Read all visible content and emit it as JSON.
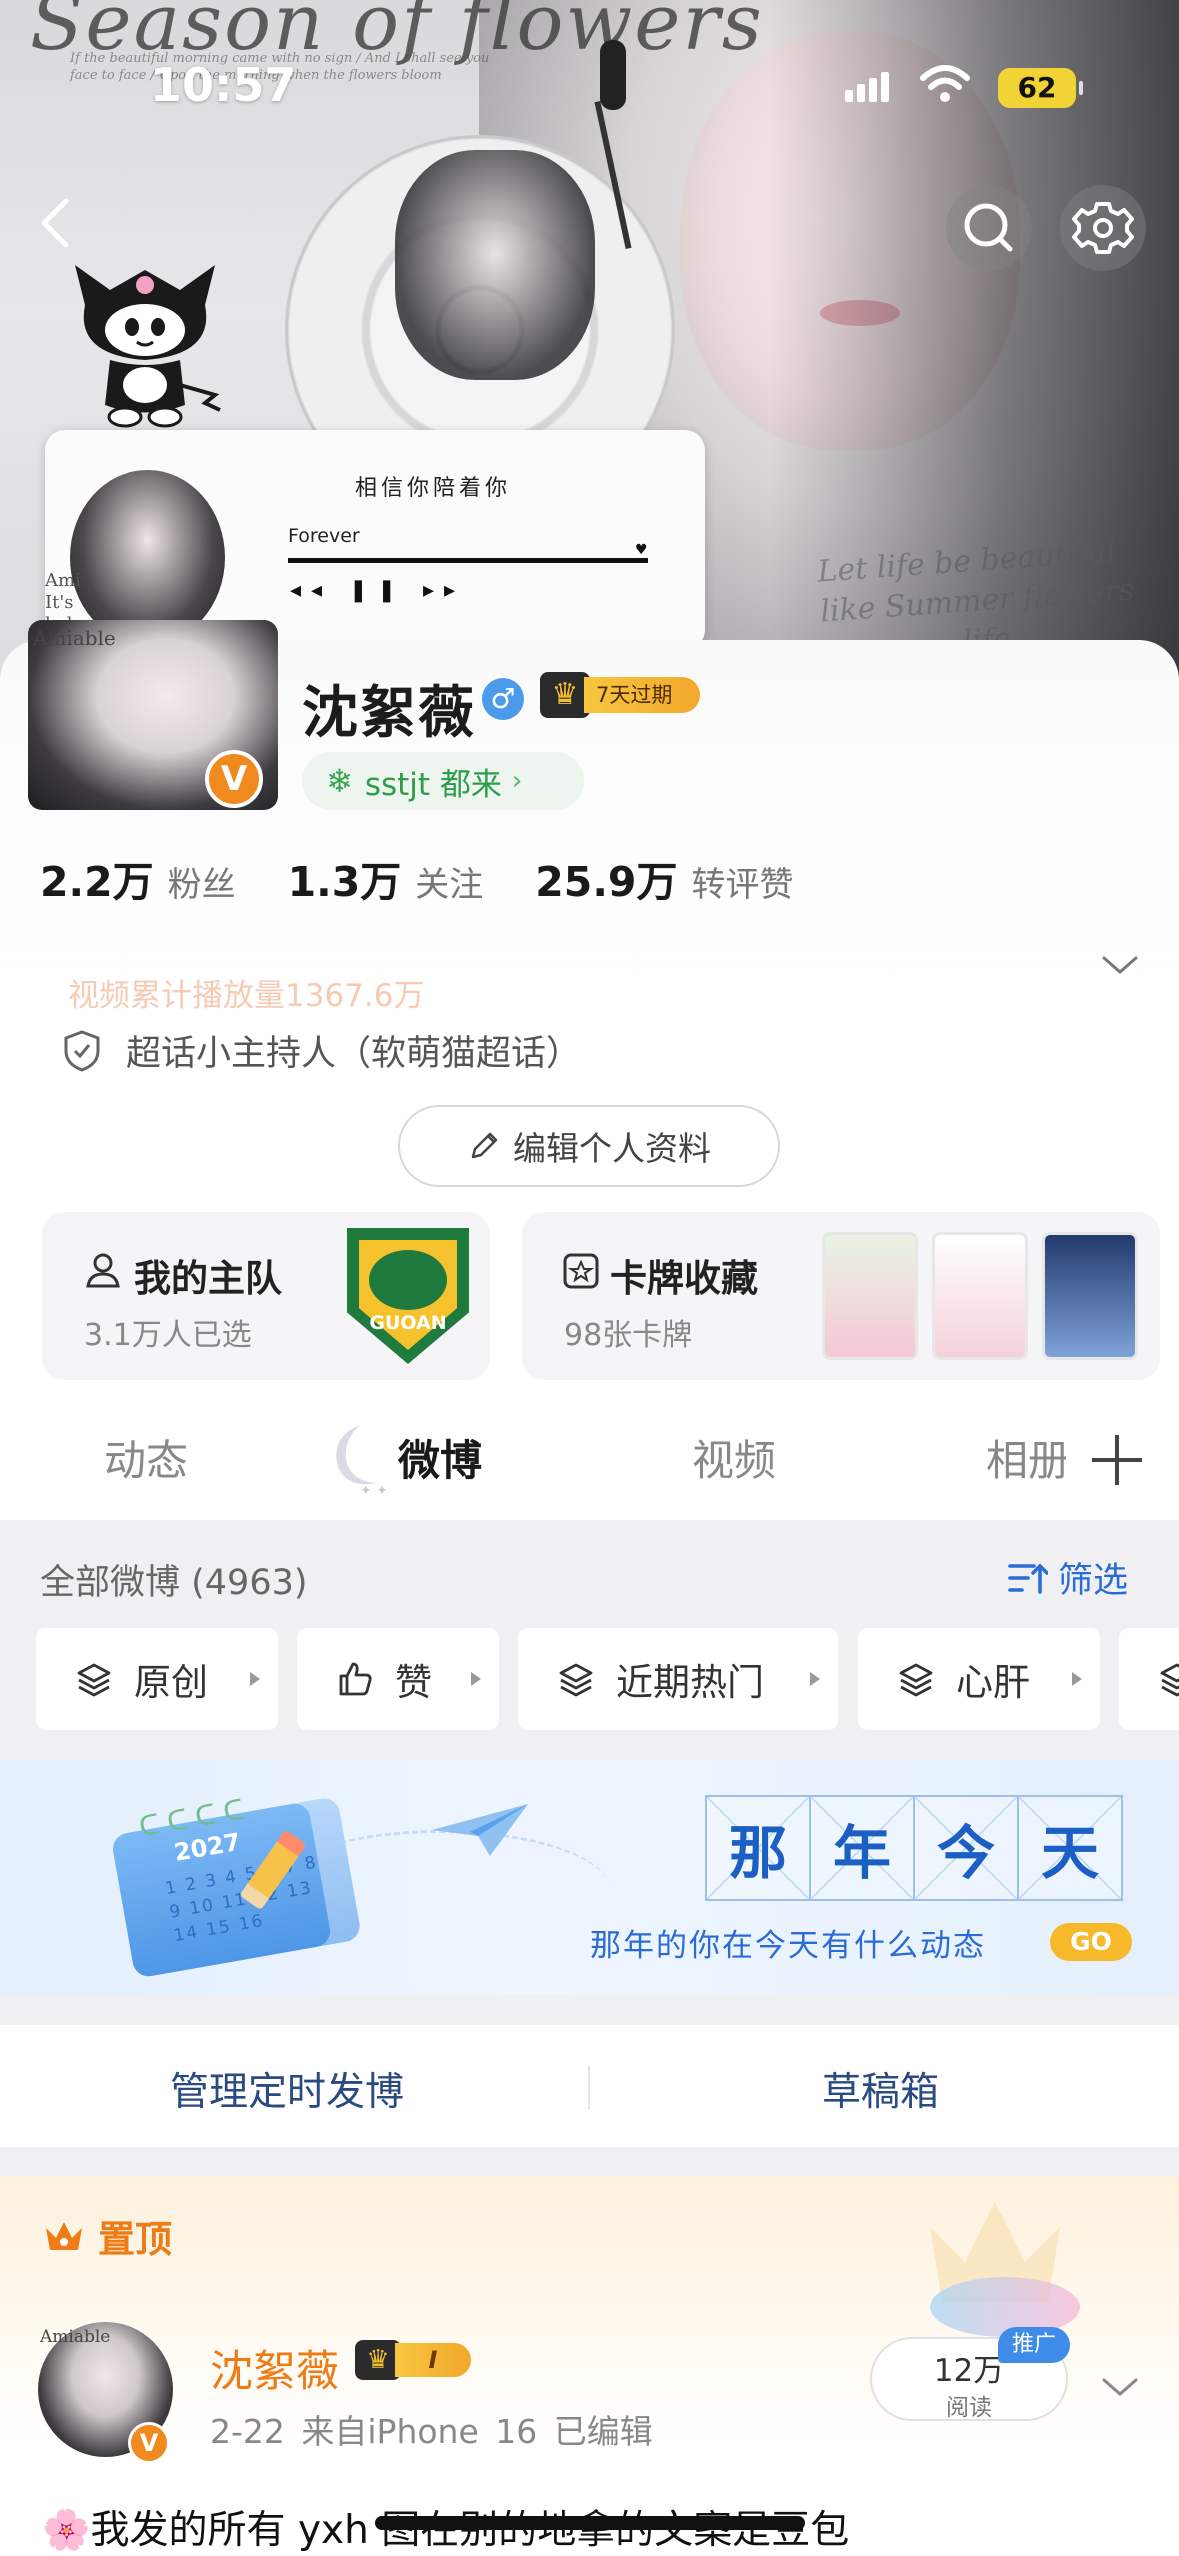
{
  "status_bar": {
    "time": "10:57",
    "battery": "62"
  },
  "cover": {
    "title_script": "Season of flowers",
    "small_script": "If the beautiful morning came with no sign / And I shall see you face to face / Upon the morning when the flowers bloom",
    "hand_text": "Let life be beautiful like Summer flowers",
    "hand_text_2": "life",
    "music_card": {
      "title": "相信你陪着你",
      "song": "Forever",
      "controls": "◂◂ ❚❚ ▸▸",
      "side_text": "Ami\nIt's\nbyl\nbyl\nsha\nshi"
    }
  },
  "profile": {
    "avatar_text": "Amiable",
    "username": "沈絮薇",
    "gender_symbol": "♂",
    "vip_label": "7天过期",
    "tag_label": "sstjt 都来",
    "stats": [
      {
        "num": "2.2万",
        "label": "粉丝"
      },
      {
        "num": "1.3万",
        "label": "关注"
      },
      {
        "num": "25.9万",
        "label": "转评赞"
      }
    ],
    "video_line": "视频累计播放量1367.6万",
    "host_line": "超话小主持人（软萌猫超话）",
    "edit_button": "编辑个人资料",
    "team_card": {
      "title": "我的主队",
      "sub": "3.1万人已选",
      "logo_text": "GUOAN"
    },
    "cards_card": {
      "title": "卡牌收藏",
      "sub": "98张卡牌"
    }
  },
  "tabs": [
    "动态",
    "微博",
    "视频",
    "相册"
  ],
  "active_tab": "微博",
  "filter": {
    "all_label": "全部微博 (4963)",
    "screen_label": "筛选",
    "chips": [
      "原创",
      "赞",
      "近期热门",
      "心肝"
    ]
  },
  "banner": {
    "year": "2027",
    "calendar_nums": "1 2 3 4 5 6 7 8 9 10 11 12 13 14 15 16",
    "title_chars": [
      "那",
      "年",
      "今",
      "天"
    ],
    "subtitle": "那年的你在今天有什么动态",
    "go": "GO"
  },
  "schedule": {
    "left": "管理定时发博",
    "right": "草稿箱"
  },
  "pinned": {
    "label": "置顶",
    "name": "沈絮薇",
    "vip_level": "I",
    "meta": "2-22  来自iPhone 16  已编辑",
    "promo_value": "12万",
    "promo_label": "阅读",
    "promo_tag": "推广",
    "text": "🌸我发的所有 yxh 图在别的地拿的文案是豆包"
  },
  "colors": {
    "accent_orange": "#ef7b14",
    "link_blue": "#2b6bd8",
    "battery": "#f2d336",
    "tag_green": "#2f9c4c"
  }
}
